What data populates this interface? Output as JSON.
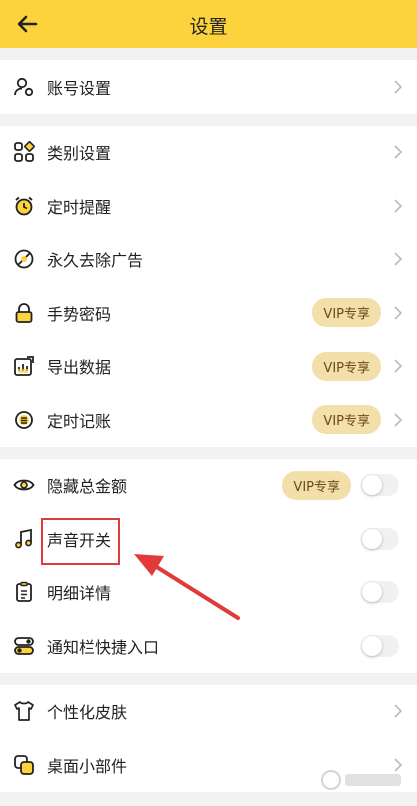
{
  "header": {
    "title": "设置"
  },
  "groups": [
    {
      "items": [
        {
          "label": "账号设置"
        }
      ]
    },
    {
      "items": [
        {
          "label": "类别设置"
        },
        {
          "label": "定时提醒"
        },
        {
          "label": "永久去除广告"
        },
        {
          "label": "手势密码",
          "badge": "VIP专享"
        },
        {
          "label": "导出数据",
          "badge": "VIP专享"
        },
        {
          "label": "定时记账",
          "badge": "VIP专享"
        }
      ]
    },
    {
      "items": [
        {
          "label": "隐藏总金额",
          "badge": "VIP专享",
          "toggle": false
        },
        {
          "label": "声音开关",
          "toggle": false
        },
        {
          "label": "明细详情",
          "toggle": false
        },
        {
          "label": "通知栏快捷入口",
          "toggle": false
        }
      ]
    },
    {
      "items": [
        {
          "label": "个性化皮肤"
        },
        {
          "label": "桌面小部件"
        }
      ]
    }
  ],
  "colors": {
    "header_bg": "#fcd33c",
    "vip_bg": "#f3dfa9",
    "annotation": "#e03a3a"
  }
}
